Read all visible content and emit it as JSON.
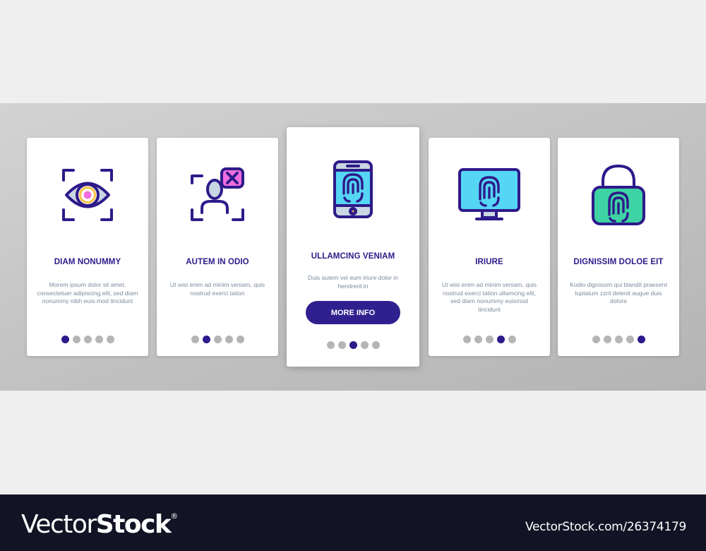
{
  "cards": [
    {
      "icon": "eye-scan-icon",
      "title": "DIAM NONUMMY",
      "text": "Morem ipsum dolor sit amet, consectetuer adipiscing elit, sed diam nonummy nibh euis-mod tincidunt",
      "active_dot": 1
    },
    {
      "icon": "face-id-rejected-icon",
      "title": "AUTEM IN ODIO",
      "text": "Ut wisi enim ad minim veniam, quis nostrud exerci tation",
      "active_dot": 2
    },
    {
      "icon": "phone-fingerprint-icon",
      "title": "ULLAMCING VENIAM",
      "text": "Duis autem vel eum iriure dolor in hendrerit in",
      "button_label": "MORE INFO",
      "active_dot": 3
    },
    {
      "icon": "monitor-fingerprint-icon",
      "title": "IRIURE",
      "text": "Ut wisi enim ad minim veniam, quis nostrud exerci tation ullamcing elit, sed diam nonummy euismod tincidunt",
      "active_dot": 4
    },
    {
      "icon": "padlock-fingerprint-icon",
      "title": "DIGNISSIM DOLOE EIT",
      "text": "Kodio dignissim qui blandit praesent luptatum zzril delenit augue duis dolore",
      "active_dot": 5
    }
  ],
  "pagination": {
    "total": 5
  },
  "colors": {
    "primary": "#2e1a8a",
    "button": "#30208f",
    "text_muted": "#7c8a9e",
    "dot_inactive": "#b5b5b5",
    "icon_cyan": "#55d6f5",
    "icon_green": "#3ed3a3",
    "icon_pink": "#f26ee0",
    "icon_yellow": "#f5c242",
    "icon_light": "#c9d6e3",
    "footer_bg": "#121425"
  },
  "footer": {
    "brand_light": "Vector",
    "brand_bold": "Stock",
    "brand_mark": "®",
    "image_id": "VectorStock.com/26374179"
  }
}
